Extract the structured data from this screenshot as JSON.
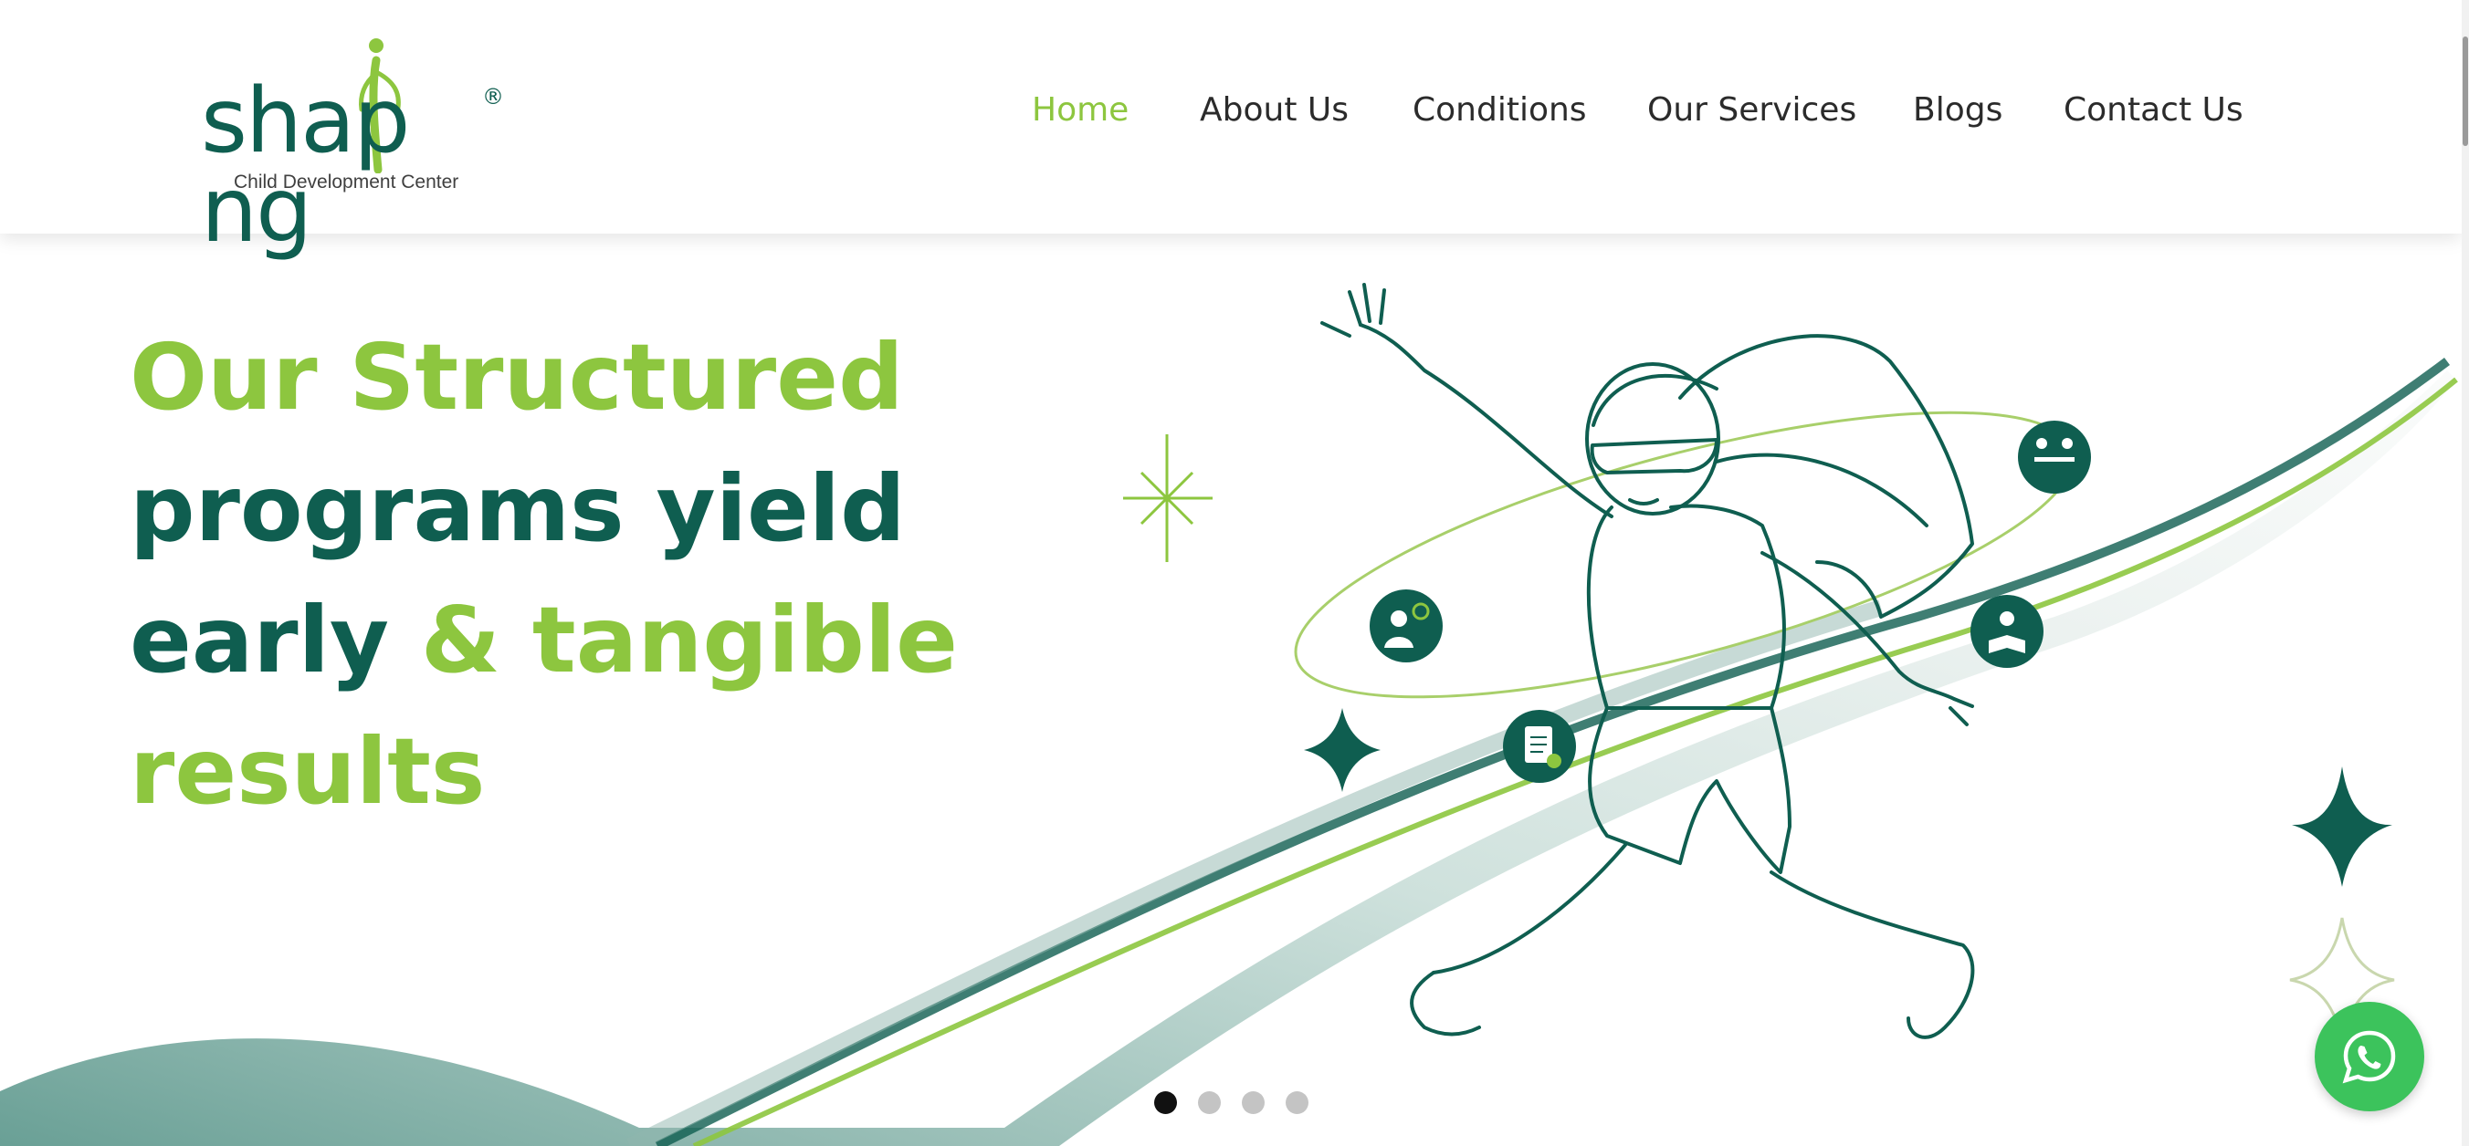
{
  "brand": {
    "name": "shap",
    "name_end": "ng",
    "registered": "®",
    "tagline": "Child Development Center",
    "colors": {
      "primary": "#0f5e50",
      "accent": "#8dc63f"
    }
  },
  "nav": {
    "items": [
      {
        "label": "Home",
        "active": true
      },
      {
        "label": "About Us",
        "active": false
      },
      {
        "label": "Conditions",
        "active": false
      },
      {
        "label": "Our Services",
        "active": false
      },
      {
        "label": "Blogs",
        "active": false
      },
      {
        "label": "Contact Us",
        "active": false
      }
    ]
  },
  "hero": {
    "headline": {
      "line1": "Our Structured",
      "line2": "programs yield",
      "line3a": "early ",
      "line3b": "& tangible",
      "line4": "results"
    },
    "slider": {
      "total": 4,
      "current": 1
    },
    "icons": [
      "therapy-session-icon",
      "reading-child-icon",
      "therapist-gear-icon",
      "clipboard-checklist-icon"
    ]
  },
  "whatsapp": {
    "icon": "whatsapp-icon"
  }
}
